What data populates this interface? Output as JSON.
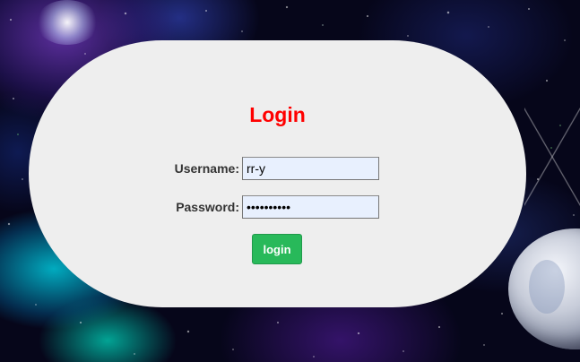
{
  "login": {
    "title": "Login",
    "username_label": "Username:",
    "username_value": "rr-y",
    "password_label": "Password:",
    "password_value": "••••••••••",
    "button_label": "login"
  },
  "colors": {
    "title": "#ff0000",
    "card_background": "#eeeeee",
    "input_background": "#e8f0fe",
    "button_background": "#28b95a",
    "button_text": "#ffffff"
  }
}
